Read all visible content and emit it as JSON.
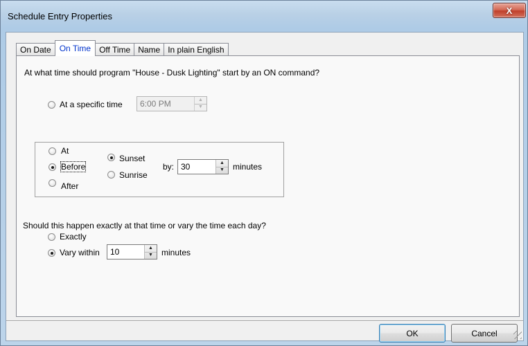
{
  "window": {
    "title": "Schedule Entry Properties",
    "close_glyph": "X"
  },
  "tabs": [
    {
      "label": "On Date",
      "active": false
    },
    {
      "label": "On Time",
      "active": true
    },
    {
      "label": "Off Time",
      "active": false
    },
    {
      "label": "Name",
      "active": false
    },
    {
      "label": "In plain English",
      "active": false
    }
  ],
  "on_time": {
    "question": "At what time should program \"House - Dusk Lighting\" start by an ON command?",
    "specific_time": {
      "label": "At a specific time",
      "selected": false,
      "value": "6:00 PM",
      "enabled": false
    },
    "relative": {
      "at_label": "At",
      "before_label": "Before",
      "after_label": "After",
      "selected": "Before",
      "sunset_label": "Sunset",
      "sunrise_label": "Sunrise",
      "event_selected": "Sunset",
      "by_label": "by:",
      "by_value": "30",
      "minutes_label": "minutes"
    },
    "vary_question": "Should this happen exactly at that time or vary the time each day?",
    "exactly_label": "Exactly",
    "vary_label": "Vary within",
    "vary_selected": true,
    "vary_value": "10",
    "vary_minutes_label": "minutes"
  },
  "buttons": {
    "ok": "OK",
    "cancel": "Cancel"
  },
  "colors": {
    "active_tab_text": "#0033cc",
    "close_button": "#c0402b"
  }
}
